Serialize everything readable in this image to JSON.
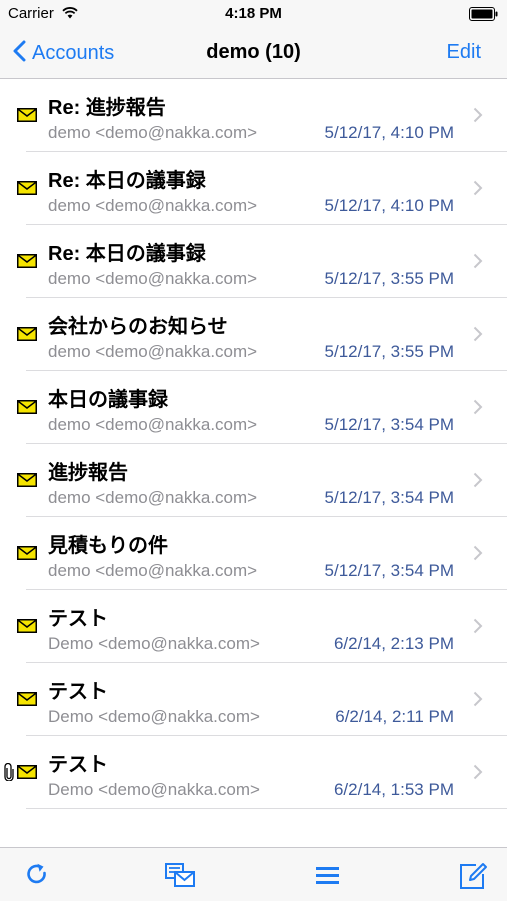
{
  "status_bar": {
    "carrier": "Carrier",
    "time": "4:18 PM"
  },
  "nav": {
    "back_label": "Accounts",
    "title": "demo (10)",
    "edit_label": "Edit"
  },
  "messages": [
    {
      "subject": "Re: 進捗報告",
      "sender": "demo <demo@nakka.com>",
      "date": "5/12/17, 4:10 PM",
      "attachment": false
    },
    {
      "subject": "Re: 本日の議事録",
      "sender": "demo <demo@nakka.com>",
      "date": "5/12/17, 4:10 PM",
      "attachment": false
    },
    {
      "subject": "Re: 本日の議事録",
      "sender": "demo <demo@nakka.com>",
      "date": "5/12/17, 3:55 PM",
      "attachment": false
    },
    {
      "subject": "会社からのお知らせ",
      "sender": "demo <demo@nakka.com>",
      "date": "5/12/17, 3:55 PM",
      "attachment": false
    },
    {
      "subject": "本日の議事録",
      "sender": "demo <demo@nakka.com>",
      "date": "5/12/17, 3:54 PM",
      "attachment": false
    },
    {
      "subject": "進捗報告",
      "sender": "demo <demo@nakka.com>",
      "date": "5/12/17, 3:54 PM",
      "attachment": false
    },
    {
      "subject": "見積もりの件",
      "sender": "demo <demo@nakka.com>",
      "date": "5/12/17, 3:54 PM",
      "attachment": false
    },
    {
      "subject": "テスト",
      "sender": "Demo <demo@nakka.com>",
      "date": "6/2/14, 2:13 PM",
      "attachment": false
    },
    {
      "subject": "テスト",
      "sender": "Demo <demo@nakka.com>",
      "date": "6/2/14, 2:11 PM",
      "attachment": false
    },
    {
      "subject": "テスト",
      "sender": "Demo <demo@nakka.com>",
      "date": "6/2/14, 1:53 PM",
      "attachment": true
    }
  ],
  "icons": {
    "mail": "envelope-icon",
    "attachment": "paperclip-icon",
    "chevron": "chevron-right-icon",
    "toolbar": [
      "refresh-icon",
      "mailbox-icon",
      "menu-icon",
      "compose-icon"
    ]
  },
  "colors": {
    "accent": "#1e7bf2",
    "envelope": "#f5e400",
    "date_text": "#3e5a9a",
    "secondary_text": "#8e8e93"
  }
}
